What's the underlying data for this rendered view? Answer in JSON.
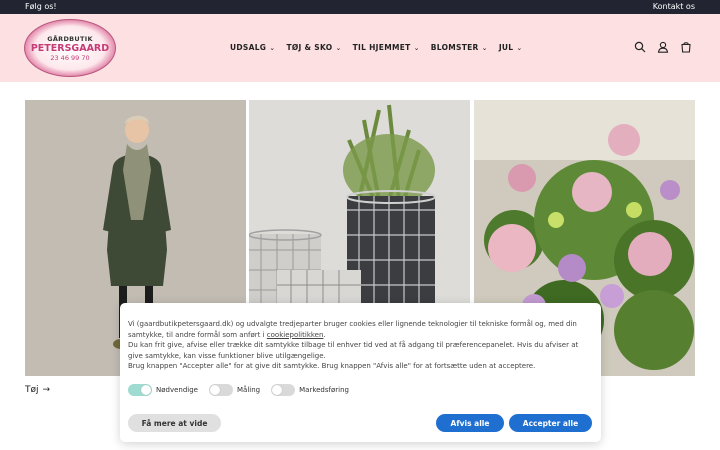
{
  "topbar": {
    "left": "Følg os!",
    "right": "Kontakt os"
  },
  "logo": {
    "line1": "GÅRDBUTIK",
    "line2": "PETERSGAARD",
    "line3": "23 46 99 70"
  },
  "nav": [
    {
      "label": "UDSALG"
    },
    {
      "label": "TØJ & SKO"
    },
    {
      "label": "TIL HJEMMET"
    },
    {
      "label": "BLOMSTER"
    },
    {
      "label": "JUL"
    }
  ],
  "icons": [
    "search-icon",
    "account-icon",
    "cart-icon"
  ],
  "gallery": {
    "caption": "Tøj",
    "arrow": "→"
  },
  "cookie": {
    "para1_before": "Vi (gaardbutikpetersgaard.dk) og udvalgte tredjeparter bruger cookies eller lignende teknologier til tekniske formål og, med din samtykke, til andre formål som anført i ",
    "policy_link": "cookiepolitikken",
    "para1_after": ".",
    "para2": "Du kan frit give, afvise eller trække dit samtykke tilbage til enhver tid ved at få adgang til præferencepanelet. Hvis du afviser at give samtykke, kan visse funktioner blive utilgængelige.",
    "para3": "Brug knappen \"Accepter alle\" for at give dit samtykke. Brug knappen \"Afvis alle\" for at fortsætte uden at acceptere.",
    "toggles": [
      {
        "label": "Nødvendige",
        "on": true
      },
      {
        "label": "Måling",
        "on": false
      },
      {
        "label": "Markedsføring",
        "on": false
      }
    ],
    "btn_more": "Få mere at vide",
    "btn_reject": "Afvis alle",
    "btn_accept": "Accepter alle"
  },
  "colors": {
    "header_bg": "#fde0e2",
    "topbar_bg": "#222531",
    "button_blue": "#1f6fd1",
    "toggle_on": "#9fdbd0"
  }
}
